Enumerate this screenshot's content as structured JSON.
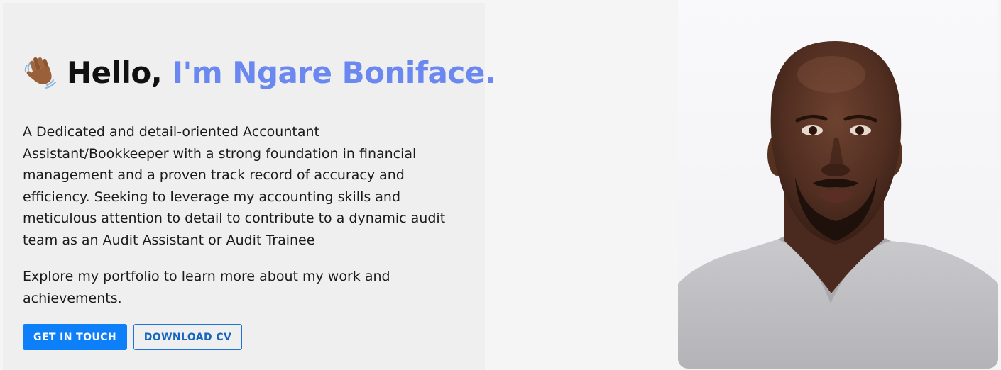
{
  "hero": {
    "greeting": "Hello, ",
    "name": "I'm Ngare Boniface.",
    "wave_icon": "waving-hand-icon",
    "intro": "A Dedicated and detail-oriented Accountant Assistant/Bookkeeper with a strong foundation in financial management and a proven track record of accuracy and efficiency. Seeking to leverage my accounting skills and meticulous attention to detail to contribute to a dynamic audit team as an Audit Assistant or Audit Trainee",
    "explore": "Explore my portfolio to learn more about my work and achievements.",
    "buttons": {
      "contact": "GET IN TOUCH",
      "download": "DOWNLOAD CV"
    }
  },
  "colors": {
    "accent_name": "#6b87f0",
    "primary_button": "#0d7ff8",
    "outline_button_text": "#1565c0"
  }
}
